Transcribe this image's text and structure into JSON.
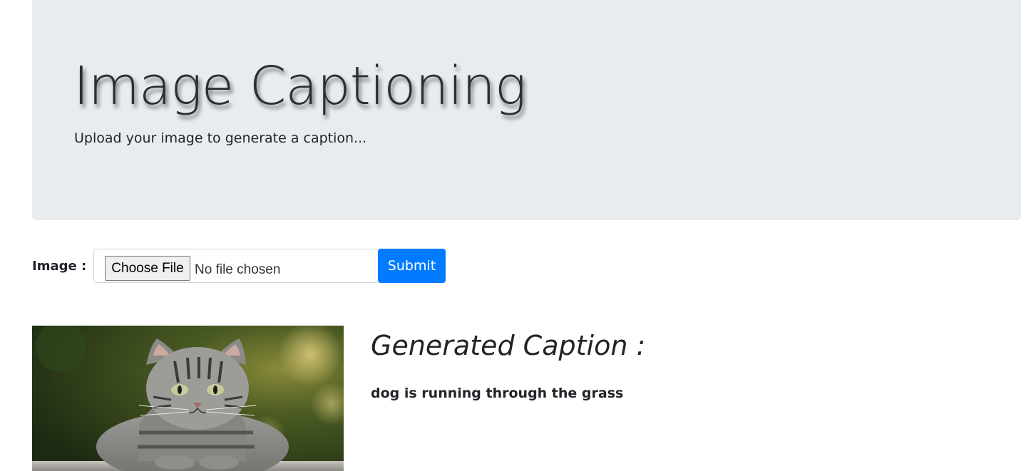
{
  "header": {
    "title": "Image Captioning",
    "subtitle": "Upload your image to generate a caption..."
  },
  "form": {
    "label": "Image :",
    "file_button_label": "Choose File",
    "file_status": "No file chosen",
    "submit_label": "Submit"
  },
  "result": {
    "heading": "Generated Caption :",
    "caption": "dog is running through the grass"
  },
  "colors": {
    "jumbotron_bg": "#e9ecef",
    "primary": "#007bff"
  }
}
